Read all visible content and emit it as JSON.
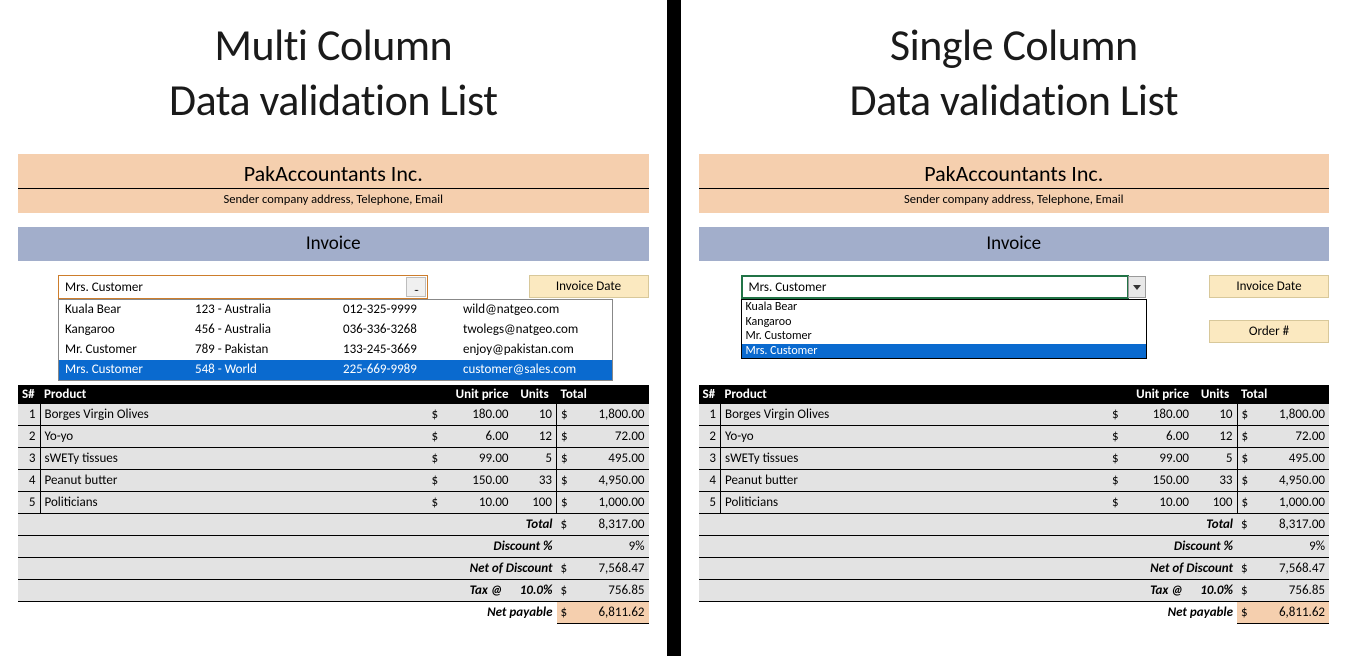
{
  "left": {
    "title": "Multi Column\nData validation List",
    "company": "PakAccountants Inc.",
    "company_sub": "Sender company address, Telephone, Email",
    "invoice_label": "Invoice",
    "combo_value": "Mrs. Customer",
    "combo_btn": "...",
    "combo_rows": [
      {
        "name": "Kuala Bear",
        "addr": "123 - Australia",
        "phone": "012-325-9999",
        "email": "wild@natgeo.com",
        "sel": false
      },
      {
        "name": "Kangaroo",
        "addr": "456 - Australia",
        "phone": "036-336-3268",
        "email": "twolegs@natgeo.com",
        "sel": false
      },
      {
        "name": "Mr. Customer",
        "addr": "789 - Pakistan",
        "phone": "133-245-3669",
        "email": "enjoy@pakistan.com",
        "sel": false
      },
      {
        "name": "Mrs. Customer",
        "addr": "548 - World",
        "phone": "225-669-9989",
        "email": "customer@sales.com",
        "sel": true
      }
    ],
    "meta_labels": [
      "Invoice Date"
    ]
  },
  "right": {
    "title": "Single Column\nData validation List",
    "company": "PakAccountants Inc.",
    "company_sub": "Sender company address, Telephone, Email",
    "invoice_label": "Invoice",
    "dd_value": "Mrs. Customer",
    "dd_items": [
      {
        "label": "Kuala Bear",
        "sel": false
      },
      {
        "label": "Kangaroo",
        "sel": false
      },
      {
        "label": "Mr. Customer",
        "sel": false
      },
      {
        "label": "Mrs. Customer",
        "sel": true
      }
    ],
    "meta_labels": [
      "Invoice Date",
      "Order #"
    ]
  },
  "table": {
    "headers": {
      "sn": "S#",
      "product": "Product",
      "unit_price": "Unit price",
      "units": "Units",
      "total": "Total"
    },
    "rows": [
      {
        "sn": "1",
        "product": "Borges Virgin Olives",
        "cur": "$",
        "price": "180.00",
        "units": "10",
        "tcur": "$",
        "total": "1,800.00"
      },
      {
        "sn": "2",
        "product": "Yo-yo",
        "cur": "$",
        "price": "6.00",
        "units": "12",
        "tcur": "$",
        "total": "72.00"
      },
      {
        "sn": "3",
        "product": "sWETy tissues",
        "cur": "$",
        "price": "99.00",
        "units": "5",
        "tcur": "$",
        "total": "495.00"
      },
      {
        "sn": "4",
        "product": "Peanut butter",
        "cur": "$",
        "price": "150.00",
        "units": "33",
        "tcur": "$",
        "total": "4,950.00"
      },
      {
        "sn": "5",
        "product": "Politicians",
        "cur": "$",
        "price": "10.00",
        "units": "100",
        "tcur": "$",
        "total": "1,000.00"
      }
    ],
    "totals": {
      "total_label": "Total",
      "total_cur": "$",
      "total_val": "8,317.00",
      "disc_label": "Discount %",
      "disc_val": "9%",
      "net_label": "Net of Discount",
      "net_cur": "$",
      "net_val": "7,568.47",
      "tax_label": "Tax @",
      "tax_rate": "10.0%",
      "tax_cur": "$",
      "tax_val": "756.85",
      "pay_label": "Net payable",
      "pay_cur": "$",
      "pay_val": "6,811.62"
    }
  }
}
